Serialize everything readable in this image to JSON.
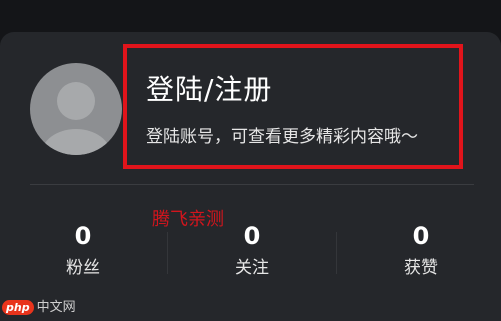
{
  "profile": {
    "login_title": "登陆/注册",
    "login_subtitle": "登陆账号，可查看更多精彩内容哦～"
  },
  "watermark": "腾飞亲测",
  "stats": [
    {
      "value": "0",
      "label": "粉丝"
    },
    {
      "value": "0",
      "label": "关注"
    },
    {
      "value": "0",
      "label": "获赞"
    }
  ],
  "site_logo": {
    "badge": "php",
    "text": "中文网"
  },
  "colors": {
    "background": "#141518",
    "card": "#25272b",
    "highlight_border": "#e1141b",
    "watermark": "#d2151d"
  },
  "icons": {
    "avatar": "default-user-avatar-icon"
  }
}
